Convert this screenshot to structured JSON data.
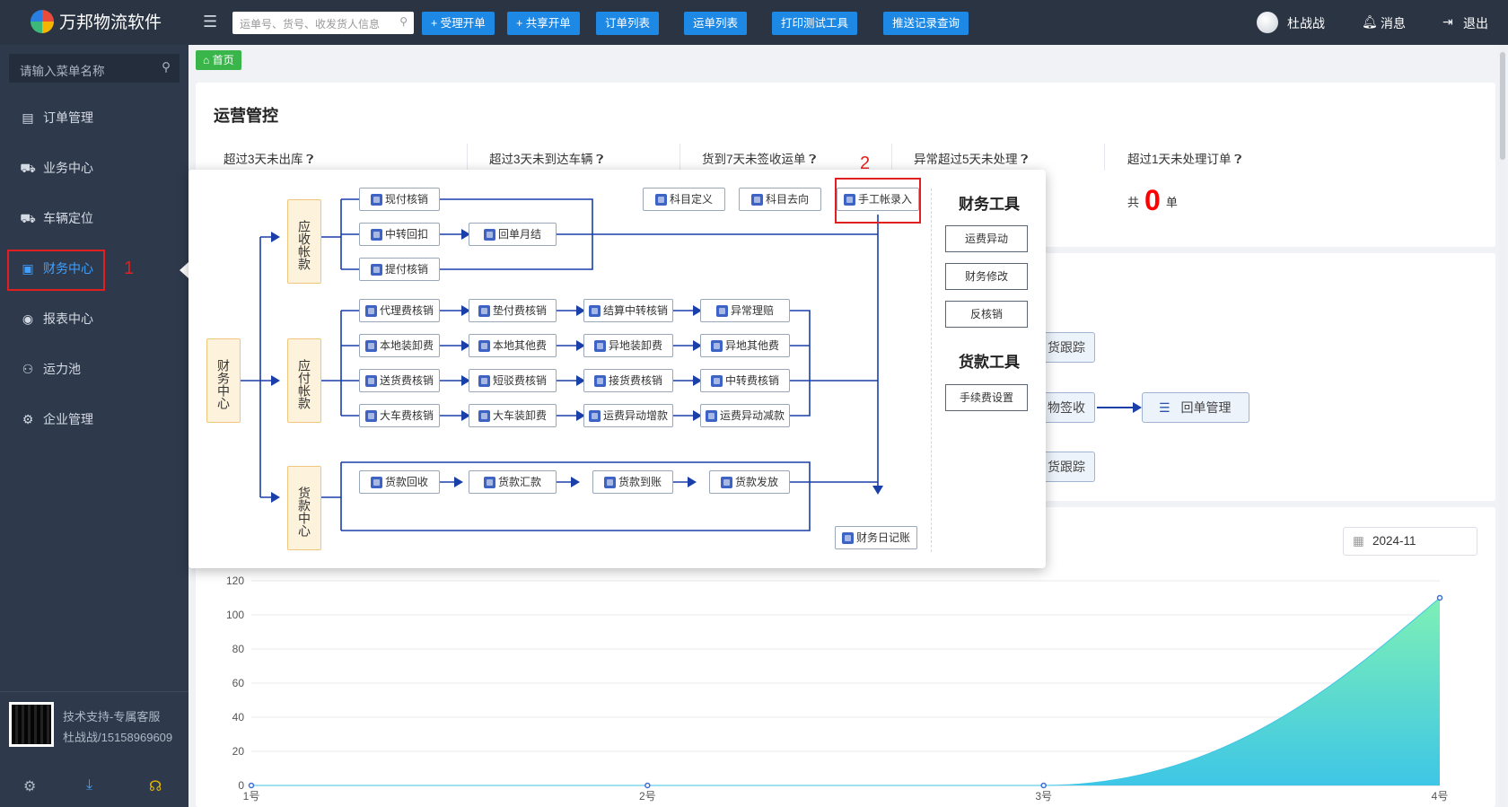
{
  "app": {
    "title": "万邦物流软件"
  },
  "topbar": {
    "search_placeholder": "运单号、货号、收发货人信息",
    "buttons": [
      "+ 受理开单",
      "+ 共享开单",
      "订单列表",
      "运单列表",
      "打印测试工具",
      "推送记录查询"
    ],
    "user": "杜战战",
    "messages": "消息",
    "logout": "退出"
  },
  "sidebar": {
    "search_placeholder": "请输入菜单名称",
    "items": [
      {
        "label": "订单管理",
        "icon": "document-icon"
      },
      {
        "label": "业务中心",
        "icon": "truck-icon"
      },
      {
        "label": "车辆定位",
        "icon": "location-truck-icon"
      },
      {
        "label": "财务中心",
        "icon": "money-icon",
        "active": true
      },
      {
        "label": "报表中心",
        "icon": "eye-chart-icon"
      },
      {
        "label": "运力池",
        "icon": "user-network-icon"
      },
      {
        "label": "企业管理",
        "icon": "user-gear-icon"
      }
    ],
    "support_line1": "技术支持-专属客服",
    "support_line2": "杜战战/15158969609"
  },
  "annotations": {
    "one": "1",
    "two": "2"
  },
  "breadcrumb": {
    "home": "首页"
  },
  "ops": {
    "title": "运营管控",
    "stats": [
      {
        "label": "超过3天未出库"
      },
      {
        "label": "超过3天未到达车辆"
      },
      {
        "label": "货到7天未签收运单"
      },
      {
        "label": "异常超过5天未处理"
      },
      {
        "label": "超过1天未处理订单"
      }
    ],
    "last_prefix": "共",
    "last_value": "0",
    "last_suffix": "单"
  },
  "background_nodes": {
    "track1": "货跟踪",
    "sign": "物签收",
    "receipt": "回单管理",
    "track2": "货跟踪"
  },
  "date_picker": {
    "value": "2024-11"
  },
  "chart_data": {
    "type": "area",
    "categories": [
      "1号",
      "2号",
      "3号",
      "4号"
    ],
    "values": [
      0,
      0,
      0,
      110
    ],
    "ylim": [
      0,
      120
    ],
    "yticks": [
      0,
      20,
      40,
      60,
      80,
      100,
      120
    ],
    "grid": true,
    "colors": [
      "#3ec6e6",
      "#7ef0b5"
    ]
  },
  "finance_flow": {
    "root": "财务中心",
    "groups": {
      "receivable": "应收帐款",
      "payable": "应付帐款",
      "payment": "货款中心"
    },
    "receivable_nodes": [
      "现付核销",
      "中转回扣",
      "回单月结",
      "提付核销"
    ],
    "payable_nodes": [
      "代理费核销",
      "垫付费核销",
      "结算中转核销",
      "异常理赔",
      "本地装卸费",
      "本地其他费",
      "异地装卸费",
      "异地其他费",
      "送货费核销",
      "短驳费核销",
      "接货费核销",
      "中转费核销",
      "大车费核销",
      "大车装卸费",
      "运费异动增款",
      "运费异动减款"
    ],
    "payment_nodes": [
      "货款回收",
      "货款汇款",
      "货款到账",
      "货款发放"
    ],
    "top_tools": [
      "科目定义",
      "科目去向",
      "手工帐录入"
    ],
    "journal": "财务日记账",
    "finance_tools_title": "财务工具",
    "finance_tools": [
      "运费异动",
      "财务修改",
      "反核销"
    ],
    "payment_tools_title": "货款工具",
    "payment_tools": [
      "手续费设置"
    ]
  }
}
